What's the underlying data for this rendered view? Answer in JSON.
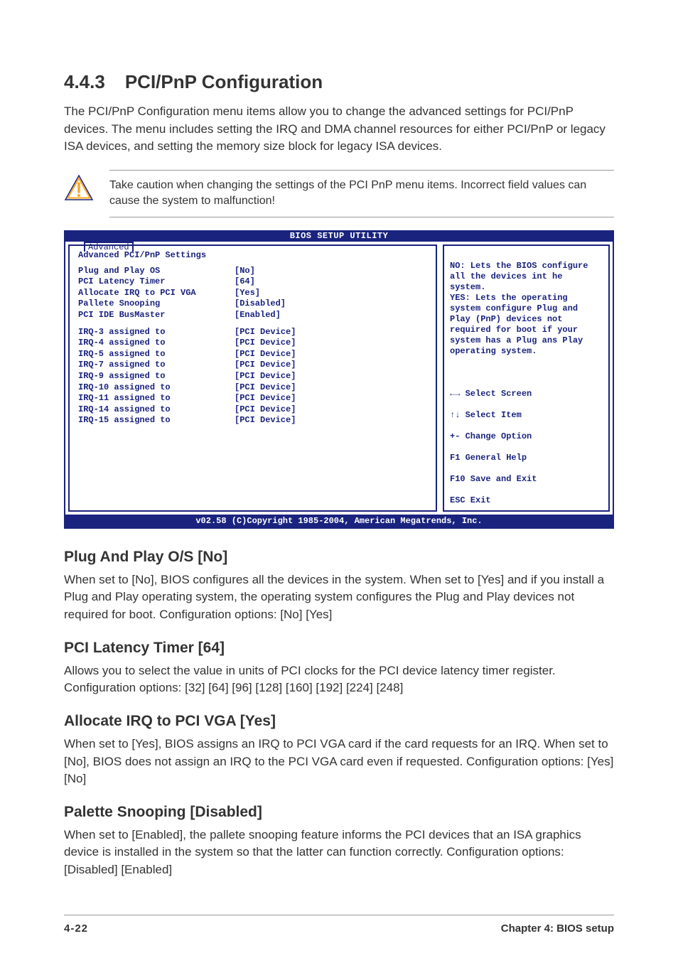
{
  "section": {
    "number": "4.4.3",
    "title": "PCI/PnP Configuration",
    "intro": "The PCI/PnP Configuration menu items allow you to change the advanced settings for PCI/PnP devices. The menu includes setting the IRQ and DMA channel resources for either PCI/PnP or legacy ISA devices, and setting the memory size block for legacy ISA devices."
  },
  "caution": "Take caution when changing the settings of the PCI PnP menu items. Incorrect field values can cause the system to malfunction!",
  "bios": {
    "title": "BIOS SETUP UTILITY",
    "tab": "Advanced",
    "subtitle": "Advanced PCI/PnP Settings",
    "rows_a": [
      {
        "label": "Plug and Play OS",
        "value": "[No]"
      },
      {
        "label": "PCI Latency Timer",
        "value": "[64]"
      },
      {
        "label": "Allocate IRQ to PCI VGA",
        "value": "[Yes]"
      },
      {
        "label": "Pallete Snooping",
        "value": "[Disabled]"
      },
      {
        "label": "PCI IDE BusMaster",
        "value": "[Enabled]"
      }
    ],
    "rows_b": [
      {
        "label": "IRQ-3 assigned to",
        "value": "[PCI Device]"
      },
      {
        "label": "IRQ-4 assigned to",
        "value": "[PCI Device]"
      },
      {
        "label": "IRQ-5 assigned to",
        "value": "[PCI Device]"
      },
      {
        "label": "IRQ-7 assigned to",
        "value": "[PCI Device]"
      },
      {
        "label": "IRQ-9 assigned to",
        "value": "[PCI Device]"
      },
      {
        "label": "IRQ-10 assigned to",
        "value": "[PCI Device]"
      },
      {
        "label": "IRQ-11 assigned to",
        "value": "[PCI Device]"
      },
      {
        "label": "IRQ-14 assigned to",
        "value": "[PCI Device]"
      },
      {
        "label": "IRQ-15 assigned to",
        "value": "[PCI Device]"
      }
    ],
    "help": "NO: Lets the BIOS configure all the devices int he system.\nYES: Lets the operating system configure Plug and Play (PnP) devices not required for boot if your system has a Plug ans Play operating system.",
    "navline1": " Select Screen",
    "navline2": "  Select Item",
    "navline3": "+-  Change Option",
    "navline4": "F1  General Help",
    "navline5": "F10 Save and Exit",
    "navline6": "ESC Exit",
    "footer": "v02.58 (C)Copyright 1985-2004, American Megatrends, Inc."
  },
  "subs": {
    "s1": {
      "title": "Plug And Play O/S [No]",
      "body": "When set to [No], BIOS configures all the devices in the system. When set to [Yes] and if you install a Plug and Play operating system, the operating system configures the Plug and Play devices not required for boot. Configuration options: [No] [Yes]"
    },
    "s2": {
      "title": "PCI Latency Timer [64]",
      "body": "Allows you to select the value in units of PCI clocks for the PCI device latency timer register. Configuration options: [32] [64] [96] [128] [160] [192] [224] [248]"
    },
    "s3": {
      "title": "Allocate IRQ to PCI VGA [Yes]",
      "body": "When set to [Yes], BIOS assigns an IRQ to PCI VGA card if the card requests for an IRQ. When set to [No], BIOS does not assign an IRQ to the PCI VGA card even if requested. Configuration options: [Yes] [No]"
    },
    "s4": {
      "title": "Palette Snooping [Disabled]",
      "body": "When set to [Enabled], the pallete snooping feature informs the PCI devices that an ISA graphics device is installed in the system so that the latter can function correctly. Configuration options: [Disabled] [Enabled]"
    }
  },
  "footer": {
    "page": "4-22",
    "chapter": "Chapter 4: BIOS setup"
  }
}
